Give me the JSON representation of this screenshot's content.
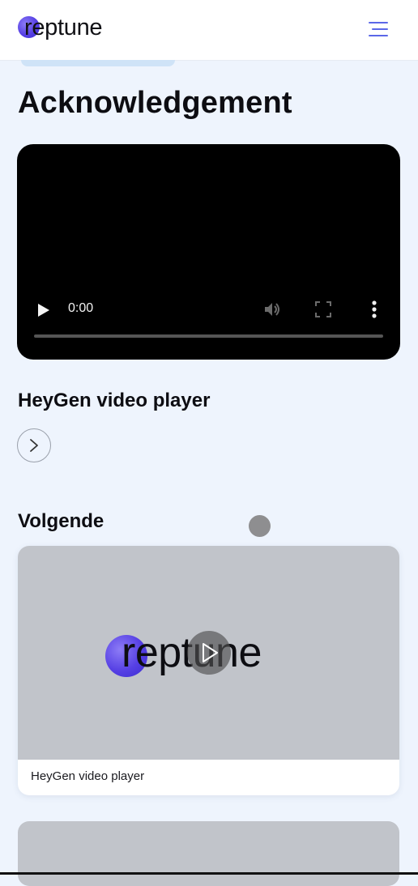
{
  "header": {
    "logo_text": "reptune",
    "brand_color": "#5640e4",
    "menu_icon": "hamburger-menu-icon"
  },
  "page": {
    "title": "Acknowledgement"
  },
  "video_player": {
    "time": "0:00",
    "icons": [
      "play-icon",
      "volume-icon",
      "fullscreen-icon",
      "more-options-icon"
    ]
  },
  "section": {
    "title": "HeyGen video player",
    "next_icon": "chevron-right-icon"
  },
  "next_section": {
    "title": "Volgende",
    "cards": [
      {
        "thumbnail_logo": "reptune",
        "caption": "HeyGen video player"
      }
    ]
  }
}
